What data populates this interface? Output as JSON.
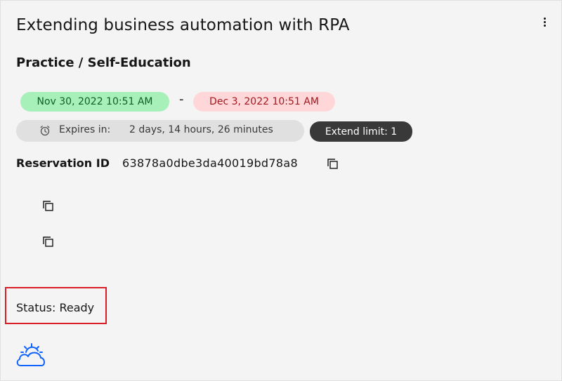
{
  "card": {
    "title": "Extending business automation with RPA",
    "subtitle": "Practice / Self-Education",
    "menu_icon": "overflow-menu-vertical-icon"
  },
  "reservation": {
    "start": "Nov 30, 2022 10:51 AM",
    "separator": "-",
    "end": "Dec 3, 2022 10:51 AM",
    "expires_label": "Expires in:",
    "expires_value": "2 days, 14 hours, 26 minutes",
    "extend_limit": "Extend limit: 1",
    "id_label": "Reservation ID",
    "id_value": "63878a0dbe3da40019bd78a8",
    "status": "Status: Ready"
  },
  "icons": {
    "clock": "alarm-clock-icon",
    "copy": "copy-icon",
    "brand": "ibm-cloud-icon"
  },
  "colors": {
    "start_bg": "#a7f0ba",
    "start_fg": "#0e6027",
    "end_bg": "#ffd7d9",
    "end_fg": "#a2191f",
    "expires_bg": "#e0e0e0",
    "extend_bg": "#393939",
    "highlight": "#da1e28",
    "brand": "#0f62fe"
  }
}
